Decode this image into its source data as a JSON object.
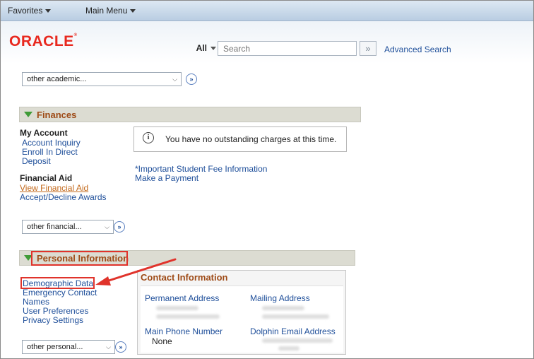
{
  "menu": {
    "favorites": "Favorites",
    "main_menu": "Main Menu"
  },
  "brand": {
    "logo": "ORACLE"
  },
  "search": {
    "scope": "All",
    "placeholder": "Search",
    "advanced": "Advanced Search"
  },
  "academic": {
    "select": "other academic..."
  },
  "finances": {
    "title": "Finances",
    "my_account_label": "My Account",
    "links": [
      "Account Inquiry",
      "Enroll In Direct",
      "Deposit"
    ],
    "financial_aid_label": "Financial Aid",
    "aid_links": [
      "View Financial Aid",
      "Accept/Decline Awards"
    ],
    "message": "You have no outstanding charges at this time.",
    "fee_links": [
      "*Important Student Fee Information",
      "Make a Payment"
    ],
    "select": "other financial..."
  },
  "personal": {
    "title": "Personal Information",
    "links": [
      "Demographic Data",
      "Emergency Contact",
      "Names",
      "User Preferences",
      "Privacy Settings"
    ],
    "select": "other personal..."
  },
  "contact": {
    "title": "Contact Information",
    "permanent_address": "Permanent Address",
    "mailing_address": "Mailing Address",
    "main_phone": "Main Phone Number",
    "phone_value": "None",
    "email": "Dolphin Email Address"
  },
  "colors": {
    "accent": "#1f4f9a",
    "section_title": "#9e4b17",
    "highlight": "#e0332b",
    "triangle": "#3f9b37",
    "logo": "#e8281e"
  }
}
